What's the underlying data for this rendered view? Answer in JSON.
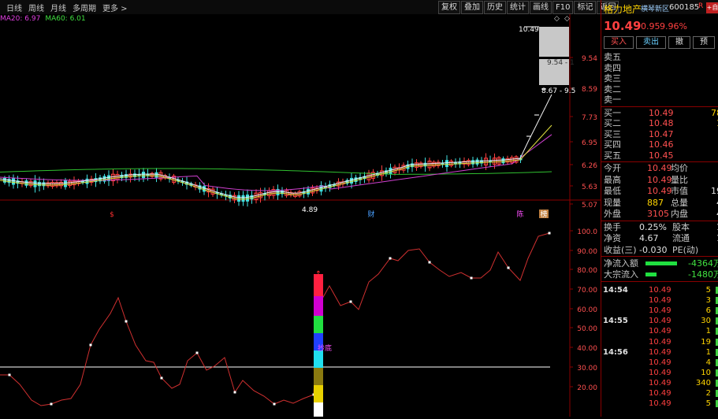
{
  "toolbar": {
    "left_items": [
      "日线",
      "周线",
      "月线",
      "多周期",
      "更多 >"
    ],
    "right_buttons": [
      "复权",
      "叠加",
      "历史",
      "统计",
      "画线",
      "F10",
      "标记",
      "返回"
    ]
  },
  "ma_labels": [
    {
      "text": "MA20: 6.97",
      "color": "#e040e0"
    },
    {
      "text": "MA60: 6.01",
      "color": "#40e040"
    }
  ],
  "price_axis": [
    "9.54",
    "8.59",
    "7.73",
    "6.95",
    "6.26",
    "5.63",
    "5.07"
  ],
  "price_annotations": {
    "high": "10.49",
    "box_upper": "9.54 - 1",
    "box_lower": "8.67 - 9.5",
    "low": "4.89"
  },
  "event_markers": [
    {
      "text": "$",
      "color": "#ff3030"
    },
    {
      "text": "财",
      "color": "#4aa0ff"
    },
    {
      "text": "陈",
      "color": "#ff50ff"
    },
    {
      "text": "榜",
      "color": "#ffffff"
    }
  ],
  "indicator_axis": [
    "100.0",
    "90.00",
    "80.00",
    "70.00",
    "60.00",
    "50.00",
    "40.00",
    "30.00",
    "20.00"
  ],
  "indicator_label": "抄底",
  "stock": {
    "name": "格力地产",
    "tag": "横琴新区",
    "code": "600185",
    "r_badge": "R",
    "self_btn": "+自",
    "price": "10.49",
    "change": "0.95",
    "change_pct": "9.96%"
  },
  "actions": [
    "买入",
    "卖出",
    "撤",
    "预"
  ],
  "sell_levels": [
    "卖五",
    "卖四",
    "卖三",
    "卖二",
    "卖一"
  ],
  "buy_levels": [
    {
      "label": "买一",
      "price": "10.49",
      "vol": "78"
    },
    {
      "label": "买二",
      "price": "10.48",
      "vol": "1"
    },
    {
      "label": "买三",
      "price": "10.47",
      "vol": ""
    },
    {
      "label": "买四",
      "price": "10.46",
      "vol": ""
    },
    {
      "label": "买五",
      "price": "10.45",
      "vol": ""
    }
  ],
  "stats": [
    {
      "l1": "今开",
      "v1": "10.49",
      "l2": "均价",
      "v2": ""
    },
    {
      "l1": "最高",
      "v1": "10.49",
      "l2": "量比",
      "v2": ""
    },
    {
      "l1": "最低",
      "v1": "10.49",
      "l2": "市值",
      "v2": "19"
    },
    {
      "l1": "现量",
      "v1": "887",
      "l2": "总量",
      "v2": "4"
    },
    {
      "l1": "外盘",
      "v1": "3105",
      "l2": "内盘",
      "v2": "4"
    }
  ],
  "stats2": [
    {
      "l1": "换手",
      "v1": "0.25%",
      "l2": "股本",
      "v2": "1"
    },
    {
      "l1": "净资",
      "v1": "4.67",
      "l2": "流通",
      "v2": "1"
    },
    {
      "l1": "收益(三)",
      "v1": "-0.030",
      "l2": "PE(动)",
      "v2": ""
    }
  ],
  "flows": [
    {
      "label": "净流入额",
      "value": "-4364万"
    },
    {
      "label": "大宗流入",
      "value": "-1480万"
    }
  ],
  "ticks": [
    {
      "time": "14:54",
      "price": "10.49",
      "vol": "5"
    },
    {
      "time": "",
      "price": "10.49",
      "vol": "3"
    },
    {
      "time": "",
      "price": "10.49",
      "vol": "6"
    },
    {
      "time": "14:55",
      "price": "10.49",
      "vol": "30"
    },
    {
      "time": "",
      "price": "10.49",
      "vol": "1"
    },
    {
      "time": "",
      "price": "10.49",
      "vol": "19"
    },
    {
      "time": "14:56",
      "price": "10.49",
      "vol": "1"
    },
    {
      "time": "",
      "price": "10.49",
      "vol": "4"
    },
    {
      "time": "",
      "price": "10.49",
      "vol": "10"
    },
    {
      "time": "",
      "price": "10.49",
      "vol": "340"
    },
    {
      "time": "",
      "price": "10.49",
      "vol": "2"
    },
    {
      "time": "",
      "price": "10.49",
      "vol": "5"
    }
  ]
}
